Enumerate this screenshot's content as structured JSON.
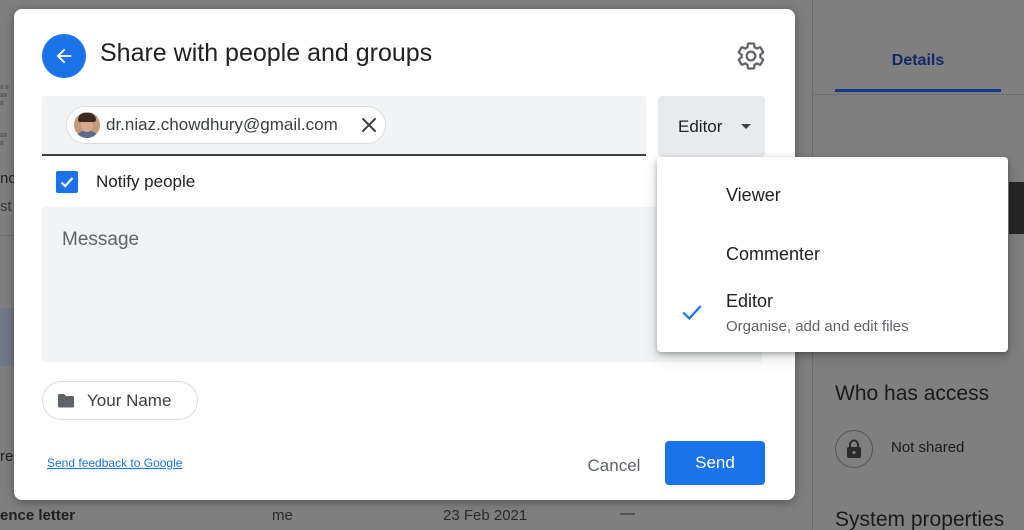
{
  "dialog": {
    "title": "Share with people and groups",
    "recipient_email": "dr.niaz.chowdhury@gmail.com",
    "role_selected": "Editor",
    "notify_label": "Notify people",
    "notify_checked": true,
    "message_placeholder": "Message",
    "folder_chip_label": "Your Name",
    "feedback_link": "Send feedback to Google",
    "cancel_label": "Cancel",
    "send_label": "Send"
  },
  "role_menu": {
    "items": [
      {
        "label": "Viewer",
        "description": "",
        "checked": false
      },
      {
        "label": "Commenter",
        "description": "",
        "checked": false
      },
      {
        "label": "Editor",
        "description": "Organise, add and edit files",
        "checked": true
      }
    ]
  },
  "background": {
    "details_tab": "Details",
    "who_has_access": "Who has access",
    "access_status": "Not shared",
    "system_properties": "System properties",
    "file_row": {
      "name": "ence letter",
      "owner": "me",
      "date": "23 Feb 2021",
      "size": "—"
    },
    "left_fragments": [
      "nc",
      "st",
      "re"
    ]
  },
  "colors": {
    "accent": "#1a73e8",
    "input_bg": "#f1f3f4",
    "menu_secondary_text": "#5f6368"
  },
  "icons": {
    "back": "arrow-left-icon",
    "settings": "gear-icon",
    "remove_chip": "close-icon",
    "role_caret": "caret-down-icon",
    "checkbox": "checkbox-checked-icon",
    "folder": "folder-icon",
    "menu_check": "check-icon",
    "access": "lock-icon"
  }
}
